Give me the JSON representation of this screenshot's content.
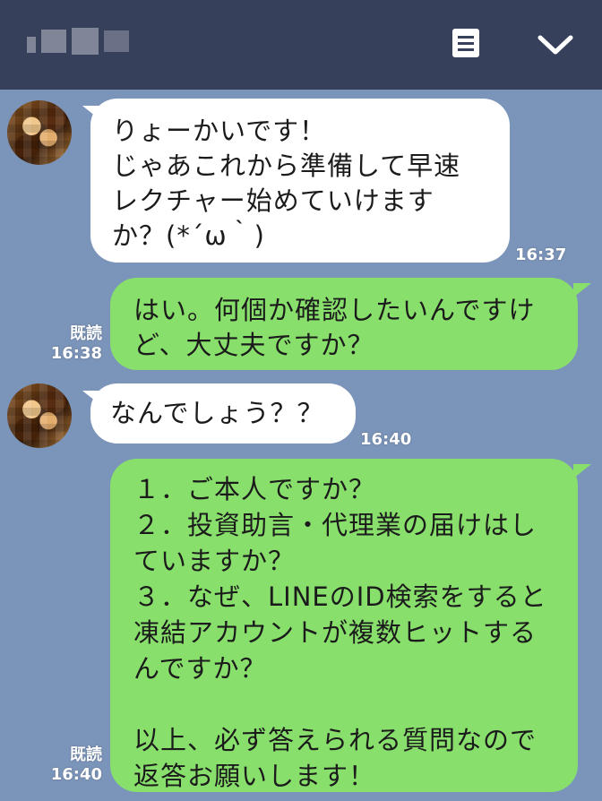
{
  "header": {
    "contact_name": "",
    "menu_icon": "menu-list-icon",
    "collapse_icon": "chevron-down-icon",
    "background": "#36405a"
  },
  "theme": {
    "chat_bg": "#7b94b9",
    "incoming_bubble": "#ffffff",
    "outgoing_bubble": "#88df6c"
  },
  "messages": [
    {
      "direction": "incoming",
      "text": "りょーかいです！\nじゃあこれから準備して早速\nレクチャー始めていけます\nか？(*´ω｀)",
      "time": "16:37"
    },
    {
      "direction": "outgoing",
      "text": "はい。何個か確認したいんですけ\nど、大丈夫ですか？",
      "read": "既読",
      "time": "16:38"
    },
    {
      "direction": "incoming",
      "text": "なんでしょう？？",
      "time": "16:40"
    },
    {
      "direction": "outgoing",
      "text": "１．ご本人ですか？\n２．投資助言・代理業の届けはし\nていますか？\n３．なぜ、LINEのID検索をすると\n凍結アカウントが複数ヒットする\nんですか？\n\n以上、必ず答えられる質問なので\n返答お願いします！",
      "read": "既読",
      "time": "16:40"
    }
  ]
}
